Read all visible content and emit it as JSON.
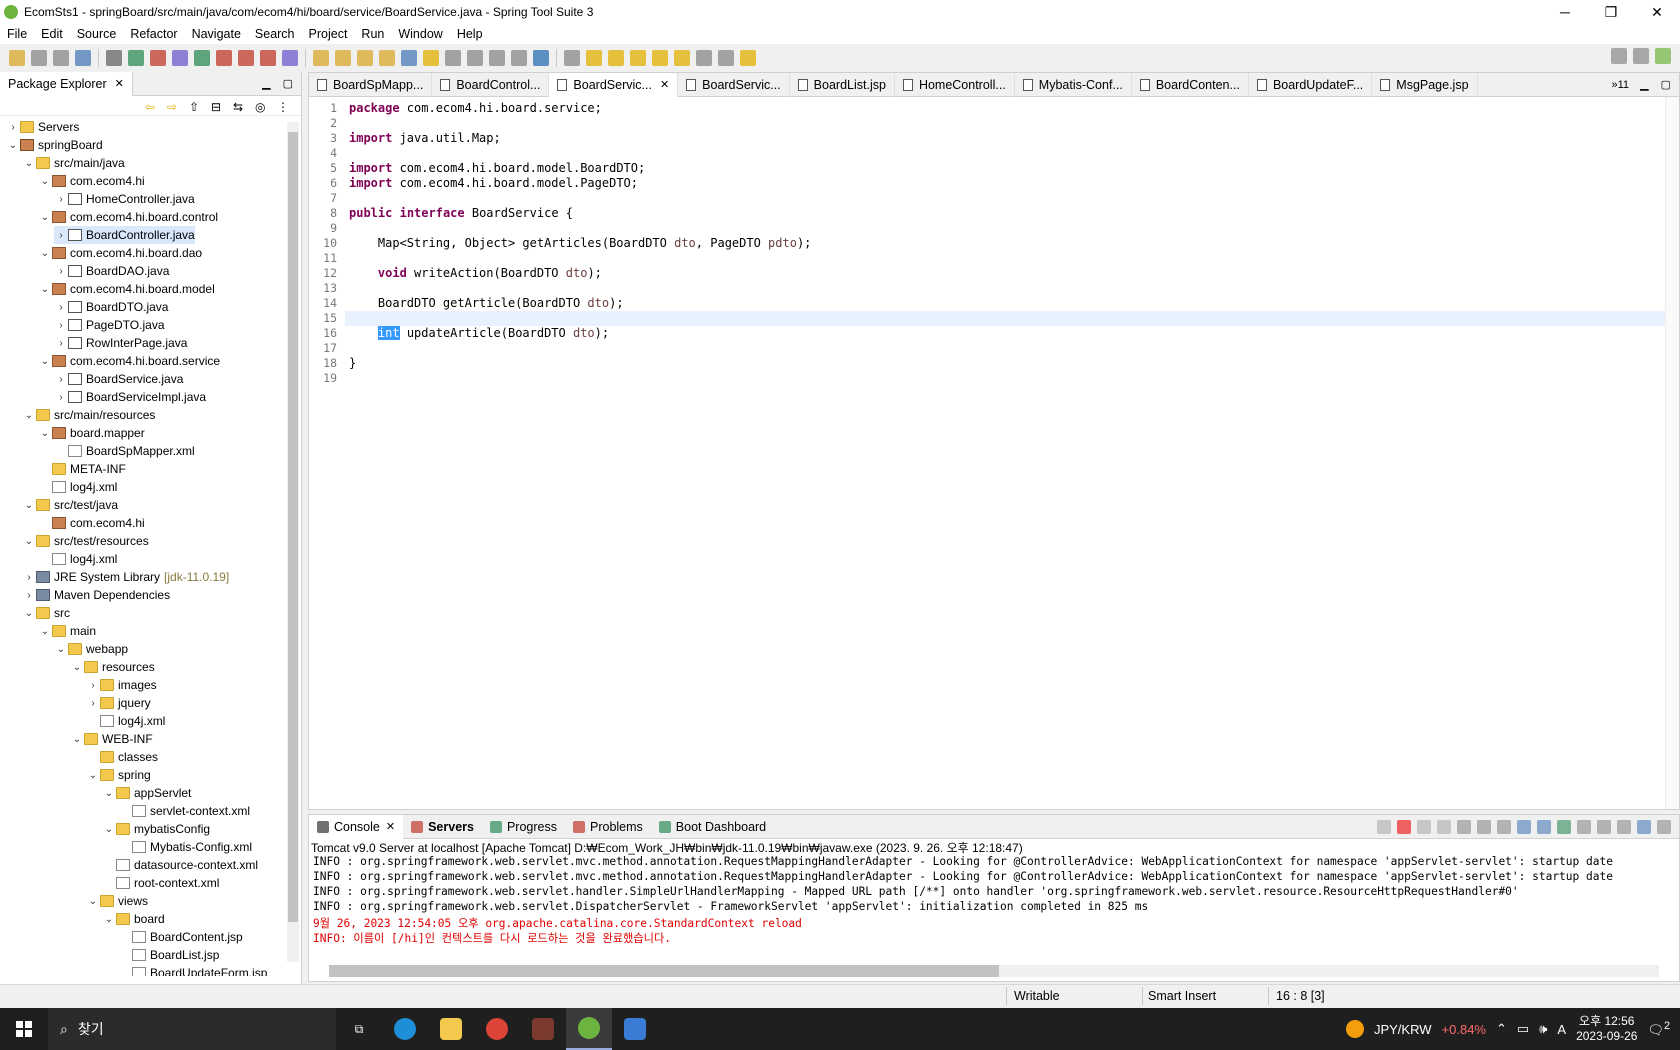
{
  "window": {
    "title": "EcomSts1 - springBoard/src/main/java/com/ecom4/hi/board/service/BoardService.java - Spring Tool Suite 3",
    "minimize": "─",
    "maximize": "❐",
    "close": "✕"
  },
  "menu": [
    "File",
    "Edit",
    "Source",
    "Refactor",
    "Navigate",
    "Search",
    "Project",
    "Run",
    "Window",
    "Help"
  ],
  "package_explorer": {
    "title": "Package Explorer",
    "nodes": [
      {
        "label": "Servers",
        "depth": 0,
        "arrow": "›",
        "icon": "folder"
      },
      {
        "label": "springBoard",
        "depth": 0,
        "arrow": "⌄",
        "icon": "proj"
      },
      {
        "label": "src/main/java",
        "depth": 1,
        "arrow": "⌄",
        "icon": "folder"
      },
      {
        "label": "com.ecom4.hi",
        "depth": 2,
        "arrow": "⌄",
        "icon": "pkg"
      },
      {
        "label": "HomeController.java",
        "depth": 3,
        "arrow": "›",
        "icon": "java"
      },
      {
        "label": "com.ecom4.hi.board.control",
        "depth": 2,
        "arrow": "⌄",
        "icon": "pkg"
      },
      {
        "label": "BoardController.java",
        "depth": 3,
        "arrow": "›",
        "icon": "java",
        "selected": true
      },
      {
        "label": "com.ecom4.hi.board.dao",
        "depth": 2,
        "arrow": "⌄",
        "icon": "pkg"
      },
      {
        "label": "BoardDAO.java",
        "depth": 3,
        "arrow": "›",
        "icon": "java"
      },
      {
        "label": "com.ecom4.hi.board.model",
        "depth": 2,
        "arrow": "⌄",
        "icon": "pkg"
      },
      {
        "label": "BoardDTO.java",
        "depth": 3,
        "arrow": "›",
        "icon": "java"
      },
      {
        "label": "PageDTO.java",
        "depth": 3,
        "arrow": "›",
        "icon": "java"
      },
      {
        "label": "RowInterPage.java",
        "depth": 3,
        "arrow": "›",
        "icon": "java"
      },
      {
        "label": "com.ecom4.hi.board.service",
        "depth": 2,
        "arrow": "⌄",
        "icon": "pkg"
      },
      {
        "label": "BoardService.java",
        "depth": 3,
        "arrow": "›",
        "icon": "java"
      },
      {
        "label": "BoardServiceImpl.java",
        "depth": 3,
        "arrow": "›",
        "icon": "java"
      },
      {
        "label": "src/main/resources",
        "depth": 1,
        "arrow": "⌄",
        "icon": "folder"
      },
      {
        "label": "board.mapper",
        "depth": 2,
        "arrow": "⌄",
        "icon": "pkg"
      },
      {
        "label": "BoardSpMapper.xml",
        "depth": 3,
        "arrow": "",
        "icon": "xml"
      },
      {
        "label": "META-INF",
        "depth": 2,
        "arrow": "",
        "icon": "folder"
      },
      {
        "label": "log4j.xml",
        "depth": 2,
        "arrow": "",
        "icon": "xml"
      },
      {
        "label": "src/test/java",
        "depth": 1,
        "arrow": "⌄",
        "icon": "folder"
      },
      {
        "label": "com.ecom4.hi",
        "depth": 2,
        "arrow": "",
        "icon": "pkg"
      },
      {
        "label": "src/test/resources",
        "depth": 1,
        "arrow": "⌄",
        "icon": "folder"
      },
      {
        "label": "log4j.xml",
        "depth": 2,
        "arrow": "",
        "icon": "xml"
      },
      {
        "label": "JRE System Library",
        "decor": "[jdk-11.0.19]",
        "depth": 1,
        "arrow": "›",
        "icon": "lib"
      },
      {
        "label": "Maven Dependencies",
        "depth": 1,
        "arrow": "›",
        "icon": "lib"
      },
      {
        "label": "src",
        "depth": 1,
        "arrow": "⌄",
        "icon": "folder"
      },
      {
        "label": "main",
        "depth": 2,
        "arrow": "⌄",
        "icon": "folder"
      },
      {
        "label": "webapp",
        "depth": 3,
        "arrow": "⌄",
        "icon": "folder"
      },
      {
        "label": "resources",
        "depth": 4,
        "arrow": "⌄",
        "icon": "folder"
      },
      {
        "label": "images",
        "depth": 5,
        "arrow": "›",
        "icon": "folder"
      },
      {
        "label": "jquery",
        "depth": 5,
        "arrow": "›",
        "icon": "folder"
      },
      {
        "label": "log4j.xml",
        "depth": 5,
        "arrow": "",
        "icon": "xml"
      },
      {
        "label": "WEB-INF",
        "depth": 4,
        "arrow": "⌄",
        "icon": "folder"
      },
      {
        "label": "classes",
        "depth": 5,
        "arrow": "",
        "icon": "folder"
      },
      {
        "label": "spring",
        "depth": 5,
        "arrow": "⌄",
        "icon": "folder"
      },
      {
        "label": "appServlet",
        "depth": 6,
        "arrow": "⌄",
        "icon": "folder"
      },
      {
        "label": "servlet-context.xml",
        "depth": 7,
        "arrow": "",
        "icon": "xml"
      },
      {
        "label": "mybatisConfig",
        "depth": 6,
        "arrow": "⌄",
        "icon": "folder"
      },
      {
        "label": "Mybatis-Config.xml",
        "depth": 7,
        "arrow": "",
        "icon": "xml"
      },
      {
        "label": "datasource-context.xml",
        "depth": 6,
        "arrow": "",
        "icon": "xml"
      },
      {
        "label": "root-context.xml",
        "depth": 6,
        "arrow": "",
        "icon": "xml"
      },
      {
        "label": "views",
        "depth": 5,
        "arrow": "⌄",
        "icon": "folder"
      },
      {
        "label": "board",
        "depth": 6,
        "arrow": "⌄",
        "icon": "folder"
      },
      {
        "label": "BoardContent.jsp",
        "depth": 7,
        "arrow": "",
        "icon": "jsp"
      },
      {
        "label": "BoardList.jsp",
        "depth": 7,
        "arrow": "",
        "icon": "jsp"
      },
      {
        "label": "BoardUpdateForm.jsp",
        "depth": 7,
        "arrow": "",
        "icon": "jsp"
      }
    ]
  },
  "editor_tabs": [
    {
      "label": "BoardSpMapp...",
      "active": false
    },
    {
      "label": "BoardControl...",
      "active": false
    },
    {
      "label": "BoardServic...",
      "active": true
    },
    {
      "label": "BoardServic...",
      "active": false
    },
    {
      "label": "BoardList.jsp",
      "active": false
    },
    {
      "label": "HomeControll...",
      "active": false
    },
    {
      "label": "Mybatis-Conf...",
      "active": false
    },
    {
      "label": "BoardConten...",
      "active": false
    },
    {
      "label": "BoardUpdateF...",
      "active": false
    },
    {
      "label": "MsgPage.jsp",
      "active": false
    }
  ],
  "editor_more": "»11",
  "code_lines": [
    "package com.ecom4.hi.board.service;",
    "",
    "import java.util.Map;",
    "",
    "import com.ecom4.hi.board.model.BoardDTO;",
    "import com.ecom4.hi.board.model.PageDTO;",
    "",
    "public interface BoardService {",
    "",
    "    Map<String, Object> getArticles(BoardDTO dto, PageDTO pdto);",
    "",
    "    void writeAction(BoardDTO dto);",
    "",
    "    BoardDTO getArticle(BoardDTO dto);",
    "",
    "    int updateArticle(BoardDTO dto);",
    "",
    "}",
    ""
  ],
  "console": {
    "tabs": [
      "Console",
      "Servers",
      "Progress",
      "Problems",
      "Boot Dashboard"
    ],
    "description": "Tomcat v9.0 Server at localhost [Apache Tomcat] D:₩Ecom_Work_JH₩bin₩jdk-11.0.19₩bin₩javaw.exe  (2023. 9. 26. 오후 12:18:47)",
    "lines": [
      {
        "text": "INFO : org.springframework.web.servlet.mvc.method.annotation.RequestMappingHandlerAdapter - Looking for @ControllerAdvice: WebApplicationContext for namespace 'appServlet-servlet': startup date",
        "red": false
      },
      {
        "text": "INFO : org.springframework.web.servlet.mvc.method.annotation.RequestMappingHandlerAdapter - Looking for @ControllerAdvice: WebApplicationContext for namespace 'appServlet-servlet': startup date",
        "red": false
      },
      {
        "text": "INFO : org.springframework.web.servlet.handler.SimpleUrlHandlerMapping - Mapped URL path [/**] onto handler 'org.springframework.web.servlet.resource.ResourceHttpRequestHandler#0'",
        "red": false
      },
      {
        "text": "INFO : org.springframework.web.servlet.DispatcherServlet - FrameworkServlet 'appServlet': initialization completed in 825 ms",
        "red": false
      },
      {
        "text": "9월 26, 2023 12:54:05 오후 org.apache.catalina.core.StandardContext reload",
        "red": true
      },
      {
        "text": "INFO: 이름이 [/hi]인 컨텍스트를 다시 로드하는 것을 완료했습니다.",
        "red": true
      }
    ]
  },
  "status": {
    "mode": "Writable",
    "insert": "Smart Insert",
    "position": "16 : 8 [3]"
  },
  "taskbar": {
    "search": "찾기",
    "ticker": "JPY/KRW",
    "ticker_change": "+0.84%",
    "time": "오후 12:56",
    "date": "2023-09-26",
    "notifications": "2"
  },
  "colors": {
    "keyword": "#7f0055",
    "selection": "#3399ff",
    "current_line": "#e8f2fe",
    "error": "#e00000"
  }
}
